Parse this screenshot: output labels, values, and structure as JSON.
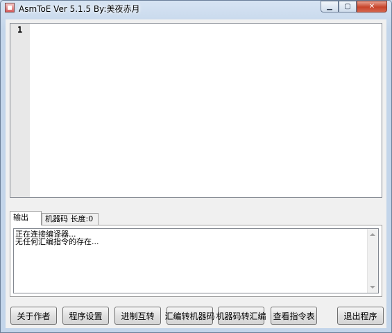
{
  "window": {
    "title": "AsmToE Ver 5.1.5  By:美夜赤月",
    "minimize_icon": "minimize-icon",
    "maximize_icon": "maximize-icon",
    "close_icon": "close-icon"
  },
  "editor": {
    "line_numbers": [
      "1"
    ],
    "content": ""
  },
  "tabs": [
    {
      "label": "输出",
      "active": true
    },
    {
      "label": "机器码 长度:0",
      "active": false
    }
  ],
  "output": {
    "lines": [
      "正在连接编译器...",
      "无任何汇编指令的存在..."
    ]
  },
  "buttons": [
    {
      "label": "关于作者"
    },
    {
      "label": "程序设置"
    },
    {
      "label": "进制互转"
    },
    {
      "label": "汇编转机器码"
    },
    {
      "label": "机器码转汇编"
    },
    {
      "label": "查看指令表"
    },
    {
      "label": "退出程序"
    }
  ]
}
